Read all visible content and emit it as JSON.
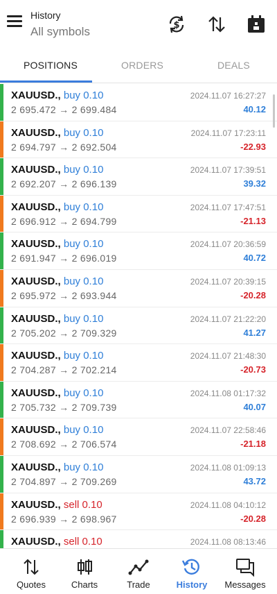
{
  "header": {
    "title_small": "History",
    "title_big": "All symbols"
  },
  "tabs": [
    {
      "label": "POSITIONS",
      "active": true
    },
    {
      "label": "ORDERS",
      "active": false
    },
    {
      "label": "DEALS",
      "active": false
    }
  ],
  "rows": [
    {
      "symbol": "XAUUSD.,",
      "side": "buy 0.10",
      "type": "buy",
      "prices": "2 695.472 → 2 699.484",
      "time": "2024.11.07 16:27:27",
      "profit": "40.12",
      "sign": "pos",
      "bar": "#33b24b"
    },
    {
      "symbol": "XAUUSD.,",
      "side": "buy 0.10",
      "type": "buy",
      "prices": "2 694.797 → 2 692.504",
      "time": "2024.11.07 17:23:11",
      "profit": "-22.93",
      "sign": "neg",
      "bar": "#f07a1e"
    },
    {
      "symbol": "XAUUSD.,",
      "side": "buy 0.10",
      "type": "buy",
      "prices": "2 692.207 → 2 696.139",
      "time": "2024.11.07 17:39:51",
      "profit": "39.32",
      "sign": "pos",
      "bar": "#33b24b"
    },
    {
      "symbol": "XAUUSD.,",
      "side": "buy 0.10",
      "type": "buy",
      "prices": "2 696.912 → 2 694.799",
      "time": "2024.11.07 17:47:51",
      "profit": "-21.13",
      "sign": "neg",
      "bar": "#f07a1e"
    },
    {
      "symbol": "XAUUSD.,",
      "side": "buy 0.10",
      "type": "buy",
      "prices": "2 691.947 → 2 696.019",
      "time": "2024.11.07 20:36:59",
      "profit": "40.72",
      "sign": "pos",
      "bar": "#33b24b"
    },
    {
      "symbol": "XAUUSD.,",
      "side": "buy 0.10",
      "type": "buy",
      "prices": "2 695.972 → 2 693.944",
      "time": "2024.11.07 20:39:15",
      "profit": "-20.28",
      "sign": "neg",
      "bar": "#f07a1e"
    },
    {
      "symbol": "XAUUSD.,",
      "side": "buy 0.10",
      "type": "buy",
      "prices": "2 705.202 → 2 709.329",
      "time": "2024.11.07 21:22:20",
      "profit": "41.27",
      "sign": "pos",
      "bar": "#33b24b"
    },
    {
      "symbol": "XAUUSD.,",
      "side": "buy 0.10",
      "type": "buy",
      "prices": "2 704.287 → 2 702.214",
      "time": "2024.11.07 21:48:30",
      "profit": "-20.73",
      "sign": "neg",
      "bar": "#f07a1e"
    },
    {
      "symbol": "XAUUSD.,",
      "side": "buy 0.10",
      "type": "buy",
      "prices": "2 705.732 → 2 709.739",
      "time": "2024.11.08 01:17:32",
      "profit": "40.07",
      "sign": "pos",
      "bar": "#33b24b"
    },
    {
      "symbol": "XAUUSD.,",
      "side": "buy 0.10",
      "type": "buy",
      "prices": "2 708.692 → 2 706.574",
      "time": "2024.11.07 22:58:46",
      "profit": "-21.18",
      "sign": "neg",
      "bar": "#f07a1e"
    },
    {
      "symbol": "XAUUSD.,",
      "side": "buy 0.10",
      "type": "buy",
      "prices": "2 704.897 → 2 709.269",
      "time": "2024.11.08 01:09:13",
      "profit": "43.72",
      "sign": "pos",
      "bar": "#33b24b"
    },
    {
      "symbol": "XAUUSD.,",
      "side": "sell 0.10",
      "type": "sell",
      "prices": "2 696.939 → 2 698.967",
      "time": "2024.11.08 04:10:12",
      "profit": "-20.28",
      "sign": "neg",
      "bar": "#f07a1e"
    },
    {
      "symbol": "XAUUSD.,",
      "side": "sell 0.10",
      "type": "sell",
      "prices": "",
      "time": "2024.11.08 08:13:46",
      "profit": "",
      "sign": "pos",
      "bar": "#33b24b"
    }
  ],
  "nav": [
    {
      "label": "Quotes",
      "icon": "quotes-icon",
      "active": false
    },
    {
      "label": "Charts",
      "icon": "charts-icon",
      "active": false
    },
    {
      "label": "Trade",
      "icon": "trade-icon",
      "active": false
    },
    {
      "label": "History",
      "icon": "history-icon",
      "active": true
    },
    {
      "label": "Messages",
      "icon": "messages-icon",
      "active": false
    }
  ],
  "colors": {
    "accent": "#3b7ddd",
    "profit_positive": "#2f7fd8",
    "profit_negative": "#d6242b",
    "win_bar": "#33b24b",
    "loss_bar": "#f07a1e"
  }
}
